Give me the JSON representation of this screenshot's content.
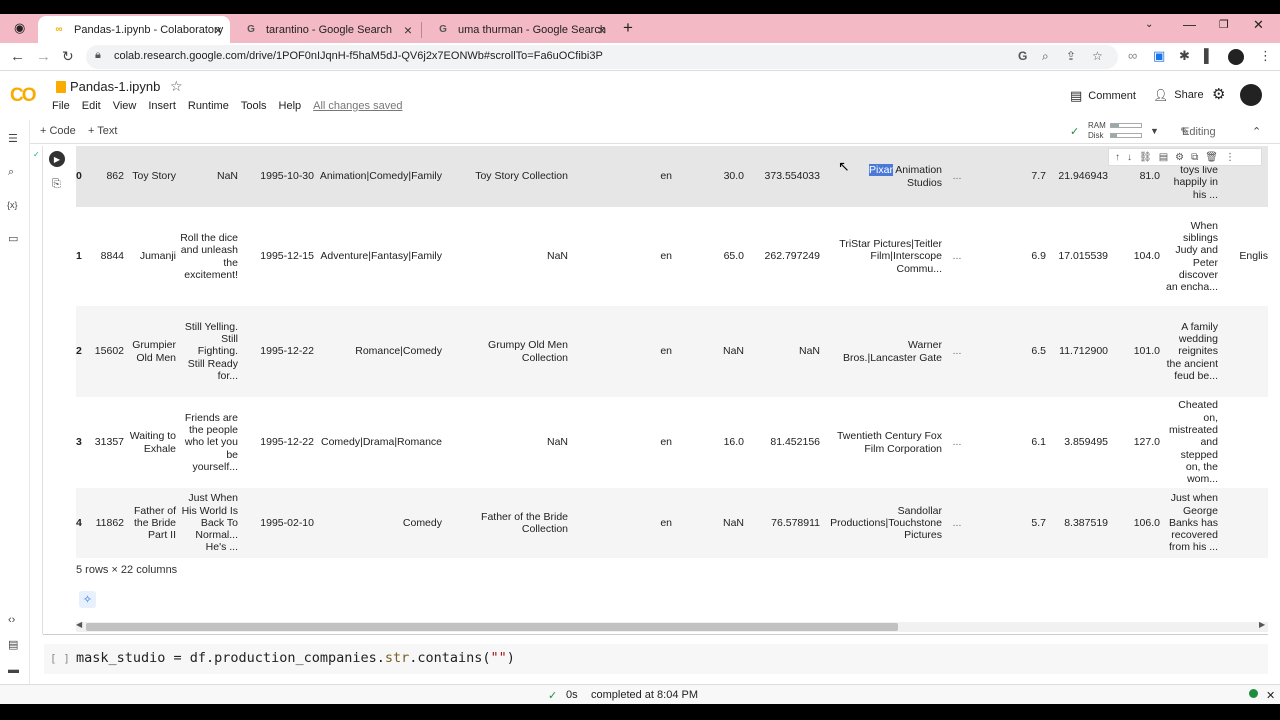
{
  "browser": {
    "tabs": [
      {
        "title": "Pandas-1.ipynb - Colaboratory",
        "icon": "colab-icon",
        "active": true
      },
      {
        "title": "tarantino - Google Search",
        "icon": "google-icon",
        "active": false
      },
      {
        "title": "uma thurman - Google Search",
        "icon": "google-icon",
        "active": false
      }
    ],
    "new_tab": "+",
    "url": "colab.research.google.com/drive/1POF0nIJqnH-f5haM5dJ-QV6j2x7EONWb#scrollTo=Fa6uOCfibi3P"
  },
  "header": {
    "logo": "CO",
    "notebook_title": "Pandas-1.ipynb",
    "menu": [
      "File",
      "Edit",
      "View",
      "Insert",
      "Runtime",
      "Tools",
      "Help"
    ],
    "save_status": "All changes saved",
    "comment_label": "Comment",
    "share_label": "Share"
  },
  "toolbar": {
    "add_code": "+ Code",
    "add_text": "+ Text",
    "ram_label": "RAM",
    "disk_label": "Disk",
    "ram_usage": 0.25,
    "disk_usage": 0.2,
    "editing_label": "Editing"
  },
  "table": {
    "rows": [
      {
        "idx": "0",
        "id": "862",
        "title": "Toy Story",
        "tagline": "NaN",
        "date": "1995-10-30",
        "genres": "Animation|Comedy|Family",
        "collection": "Toy Story Collection",
        "lang": "en",
        "budget": "30.0",
        "revenue": "373.554033",
        "company_sel": "Pixar",
        "company_rest": " Animation Studios",
        "ellipsis": "...",
        "vote": "7.7",
        "popularity": "21.946943",
        "runtime": "81.0",
        "overview": "Woody, toys live happily in his ...",
        "spoken": ""
      },
      {
        "idx": "1",
        "id": "8844",
        "title": "Jumanji",
        "tagline": "Roll the dice and unleash the excitement!",
        "date": "1995-12-15",
        "genres": "Adventure|Fantasy|Family",
        "collection": "NaN",
        "lang": "en",
        "budget": "65.0",
        "revenue": "262.797249",
        "company": "TriStar Pictures|Teitler Film|Interscope Commu...",
        "ellipsis": "...",
        "vote": "6.9",
        "popularity": "17.015539",
        "runtime": "104.0",
        "overview": "When siblings Judy and Peter discover an encha...",
        "spoken": "Englis"
      },
      {
        "idx": "2",
        "id": "15602",
        "title": "Grumpier Old Men",
        "tagline": "Still Yelling. Still Fighting. Still Ready for...",
        "date": "1995-12-22",
        "genres": "Romance|Comedy",
        "collection": "Grumpy Old Men Collection",
        "lang": "en",
        "budget": "NaN",
        "revenue": "NaN",
        "company": "Warner Bros.|Lancaster Gate",
        "ellipsis": "...",
        "vote": "6.5",
        "popularity": "11.712900",
        "runtime": "101.0",
        "overview": "A family wedding reignites the ancient feud be...",
        "spoken": ""
      },
      {
        "idx": "3",
        "id": "31357",
        "title": "Waiting to Exhale",
        "tagline": "Friends are the people who let you be yourself...",
        "date": "1995-12-22",
        "genres": "Comedy|Drama|Romance",
        "collection": "NaN",
        "lang": "en",
        "budget": "16.0",
        "revenue": "81.452156",
        "company": "Twentieth Century Fox Film Corporation",
        "ellipsis": "...",
        "vote": "6.1",
        "popularity": "3.859495",
        "runtime": "127.0",
        "overview": "Cheated on, mistreated and stepped on, the wom...",
        "spoken": ""
      },
      {
        "idx": "4",
        "id": "11862",
        "title": "Father of the Bride Part II",
        "tagline": "Just When His World Is Back To Normal... He's ...",
        "date": "1995-02-10",
        "genres": "Comedy",
        "collection": "Father of the Bride Collection",
        "lang": "en",
        "budget": "NaN",
        "revenue": "76.578911",
        "company": "Sandollar Productions|Touchstone Pictures",
        "ellipsis": "...",
        "vote": "5.7",
        "popularity": "8.387519",
        "runtime": "106.0",
        "overview": "Just when George Banks has recovered from his ...",
        "spoken": ""
      }
    ],
    "shape": "5 rows × 22 columns"
  },
  "code_cell": {
    "bracket": "[ ]",
    "var": "mask_studio = df.production_companies.",
    "fn": "str",
    "rest": ".contains(",
    "str": "\"\"",
    "close": ")"
  },
  "status": {
    "check": "✓",
    "elapsed": "0s",
    "completed": "completed at 8:04 PM"
  }
}
